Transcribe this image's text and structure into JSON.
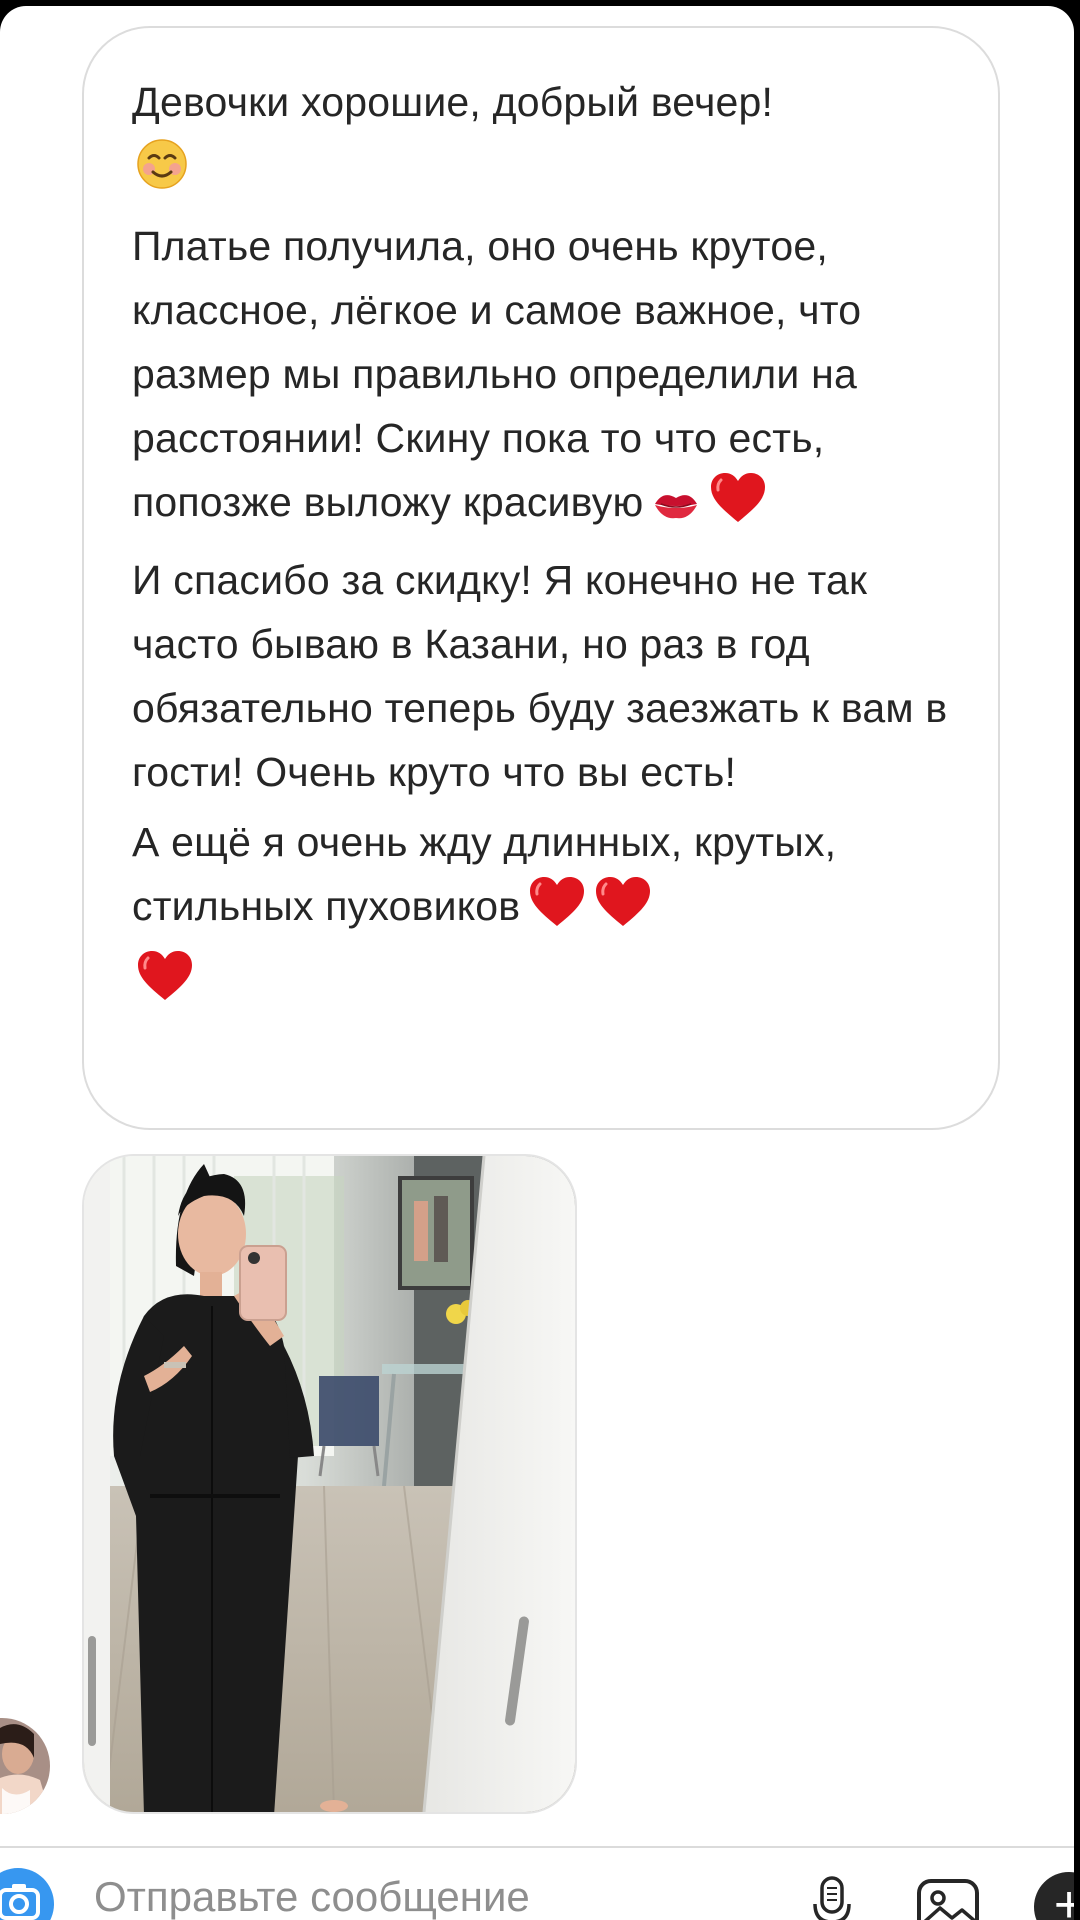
{
  "message": {
    "paragraphs": [
      "Девочки хорошие, добрый вечер!",
      "Платье получила, оно очень крутое, классное, лёгкое и самое важное, что размер мы правильно определили на расстоянии! Скину пока то что есть, попозже выложу красивую",
      "И спасибо за скидку! Я конечно не так часто бываю в Казани, но раз в год обязательно теперь буду заезжать к вам в гости! Очень круто что вы есть!",
      "А ещё я очень жду длинных, крутых, стильных пуховиков"
    ],
    "emoji": {
      "smile": "smiling-face-icon",
      "kiss": "kiss-mark-icon",
      "heart": "red-heart-icon"
    }
  },
  "composer": {
    "placeholder": "Отправьте сообщение"
  },
  "colors": {
    "accent": "#3797f0",
    "text": "#262626",
    "placeholder": "#8e8e8e",
    "heart": "#e0161e"
  }
}
